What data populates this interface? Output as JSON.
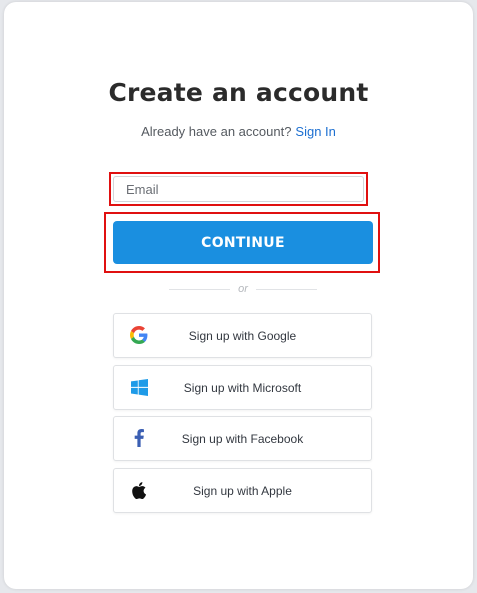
{
  "title": "Create an account",
  "subtitle": {
    "text": "Already have an account?",
    "link": "Sign In"
  },
  "email": {
    "placeholder": "Email",
    "value": ""
  },
  "continue_label": "CONTINUE",
  "divider_text": "or",
  "social": [
    {
      "label": "Sign up with Google",
      "icon": "google-icon"
    },
    {
      "label": "Sign up with Microsoft",
      "icon": "microsoft-icon"
    },
    {
      "label": "Sign up with Facebook",
      "icon": "facebook-icon"
    },
    {
      "label": "Sign up with Apple",
      "icon": "apple-icon"
    }
  ],
  "colors": {
    "primary": "#1a8fe0",
    "link": "#1c6fd1",
    "highlight_border": "#e01010"
  }
}
